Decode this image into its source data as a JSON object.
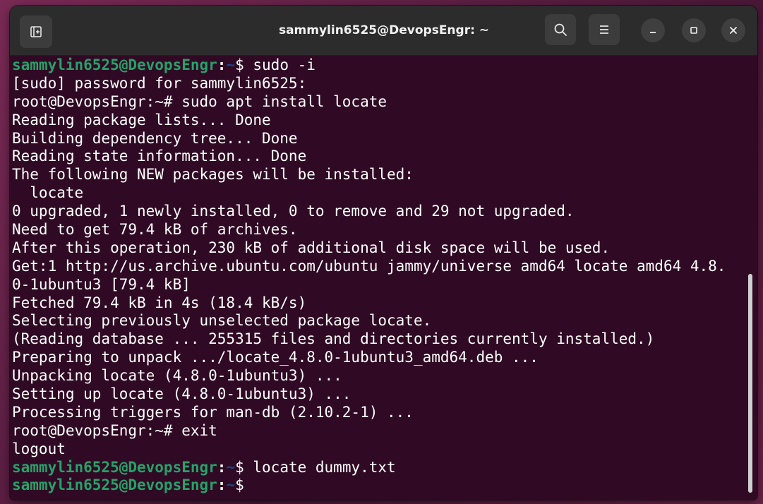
{
  "window": {
    "title": "sammylin6525@DevopsEngr: ~"
  },
  "icons": {
    "new_tab": "new-tab-icon",
    "search": "search-icon",
    "menu": "hamburger-menu-icon",
    "minimize": "minimize-icon",
    "maximize": "maximize-icon",
    "close": "close-icon"
  },
  "colors": {
    "terminal_bg": "#300a24",
    "prompt_user": "#26a269",
    "prompt_path": "#12488b",
    "text": "#ffffff"
  },
  "terminal": {
    "lines": [
      {
        "user": "sammylin6525@DevopsEngr",
        "sep": ":",
        "path": "~",
        "cmd": "$ sudo -i"
      },
      {
        "text": "[sudo] password for sammylin6525:"
      },
      {
        "text": "root@DevopsEngr:~# sudo apt install locate"
      },
      {
        "text": "Reading package lists... Done"
      },
      {
        "text": "Building dependency tree... Done"
      },
      {
        "text": "Reading state information... Done"
      },
      {
        "text": "The following NEW packages will be installed:"
      },
      {
        "text": "  locate"
      },
      {
        "text": "0 upgraded, 1 newly installed, 0 to remove and 29 not upgraded."
      },
      {
        "text": "Need to get 79.4 kB of archives."
      },
      {
        "text": "After this operation, 230 kB of additional disk space will be used."
      },
      {
        "text": "Get:1 http://us.archive.ubuntu.com/ubuntu jammy/universe amd64 locate amd64 4.8."
      },
      {
        "text": "0-1ubuntu3 [79.4 kB]"
      },
      {
        "text": "Fetched 79.4 kB in 4s (18.4 kB/s)"
      },
      {
        "text": "Selecting previously unselected package locate."
      },
      {
        "text": "(Reading database ... 255315 files and directories currently installed.)"
      },
      {
        "text": "Preparing to unpack .../locate_4.8.0-1ubuntu3_amd64.deb ..."
      },
      {
        "text": "Unpacking locate (4.8.0-1ubuntu3) ..."
      },
      {
        "text": "Setting up locate (4.8.0-1ubuntu3) ..."
      },
      {
        "text": "Processing triggers for man-db (2.10.2-1) ..."
      },
      {
        "text": "root@DevopsEngr:~# exit"
      },
      {
        "text": "logout"
      },
      {
        "user": "sammylin6525@DevopsEngr",
        "sep": ":",
        "path": "~",
        "cmd": "$ locate dummy.txt"
      },
      {
        "user": "sammylin6525@DevopsEngr",
        "sep": ":",
        "path": "~",
        "cmd": "$ "
      }
    ]
  }
}
